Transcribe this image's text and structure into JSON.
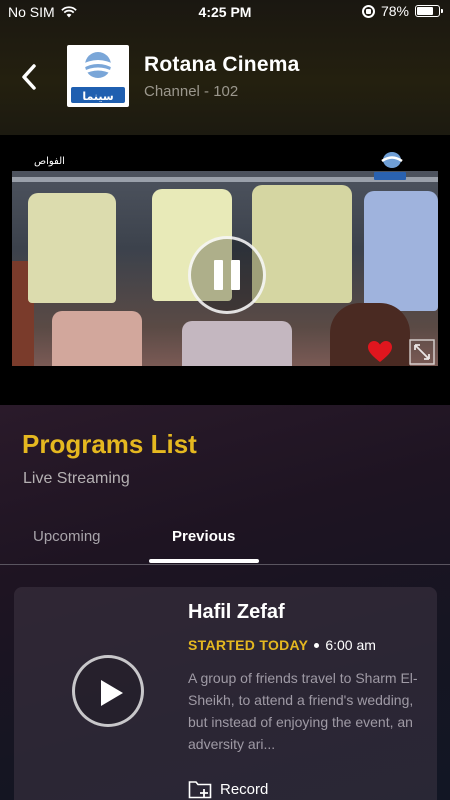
{
  "status_bar": {
    "carrier": "No SIM",
    "time": "4:25 PM",
    "battery": "78%",
    "battery_level": 0.78
  },
  "header": {
    "channel_name": "Rotana Cinema",
    "channel_number": "Channel - 102",
    "logo_text": "سينما"
  },
  "video": {
    "overlay_tag": "الفواص",
    "is_favorite": true,
    "state": "playing"
  },
  "programs": {
    "title": "Programs List",
    "subtitle": "Live Streaming",
    "tabs": [
      {
        "label": "Upcoming",
        "active": false
      },
      {
        "label": "Previous",
        "active": true
      }
    ],
    "items": [
      {
        "title": "Hafil Zefaf",
        "status": "STARTED TODAY",
        "time": "6:00 am",
        "description": "A group of friends travel to Sharm El-Sheikh, to attend a friend's wedding, but instead of enjoying the event, an adversity ari...",
        "record_label": "Record"
      }
    ]
  },
  "colors": {
    "accent": "#e5b820",
    "heart": "#e0161e"
  }
}
